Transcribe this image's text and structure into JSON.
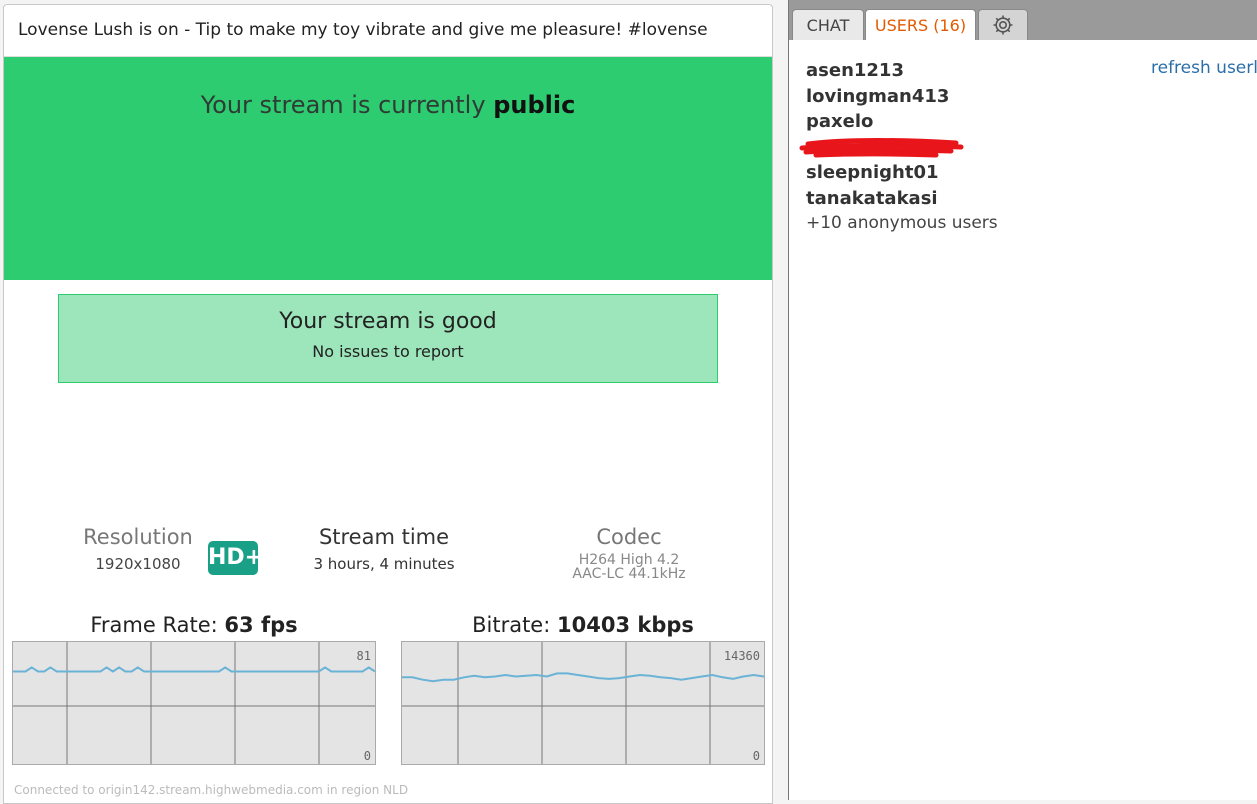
{
  "title": "Lovense Lush is on - Tip to make my toy vibrate and give me pleasure! #lovense",
  "banner": {
    "prefix": "Your stream is currently",
    "state": "public"
  },
  "status": {
    "heading": "Your stream is good",
    "detail": "No issues to report"
  },
  "stats": {
    "resolution": {
      "label": "Resolution",
      "value": "1920x1080",
      "badge": "HD+"
    },
    "stream_time": {
      "label": "Stream time",
      "value": "3 hours, 4 minutes"
    },
    "codec": {
      "label": "Codec",
      "video": "H264 High 4.2",
      "audio": "AAC-LC 44.1kHz"
    }
  },
  "framerate": {
    "label": "Frame Rate:",
    "value": "63 fps",
    "max_label": "81",
    "min_label": "0",
    "max": 81,
    "samples": [
      64,
      64,
      64,
      67,
      64,
      64,
      67,
      64,
      64,
      64,
      64,
      64,
      64,
      64,
      64,
      67,
      64,
      67,
      64,
      64,
      67,
      64,
      64,
      64,
      64,
      64,
      64,
      64,
      64,
      64,
      64,
      64,
      64,
      64,
      67,
      64,
      64,
      64,
      64,
      64,
      64,
      64,
      64,
      64,
      64,
      64,
      64,
      64,
      64,
      64,
      67,
      64,
      64,
      64,
      64,
      64,
      64,
      67,
      64
    ]
  },
  "bitrate": {
    "label": "Bitrate:",
    "value": "10403 kbps",
    "max_label": "14360",
    "min_label": "0",
    "max": 14360,
    "samples": [
      10600,
      10600,
      10300,
      10100,
      10300,
      10300,
      10600,
      10800,
      10600,
      10700,
      10900,
      10700,
      10800,
      10900,
      10700,
      11100,
      11100,
      10900,
      10700,
      10500,
      10400,
      10500,
      10700,
      10900,
      10800,
      10600,
      10500,
      10300,
      10500,
      10700,
      10900,
      10600,
      10400,
      10700,
      10900,
      10700
    ]
  },
  "footer": "Connected to origin142.stream.highwebmedia.com in region NLD",
  "tabs": {
    "chat": "CHAT",
    "users": "USERS (16)"
  },
  "icons": {
    "settings": "gear-icon"
  },
  "colors": {
    "banner": "#2ecc71",
    "status_bg": "#9de6bb",
    "hd_badge": "#1aa086",
    "active_tab": "#e35a00",
    "graph_line": "#6ab3d6"
  },
  "users": [
    "asen1213",
    "lovingman413",
    "paxelo",
    "",
    "sleepnight01",
    "tanakatakasi"
  ],
  "anonymous": "+10 anonymous users",
  "refresh_label": "refresh userlist"
}
